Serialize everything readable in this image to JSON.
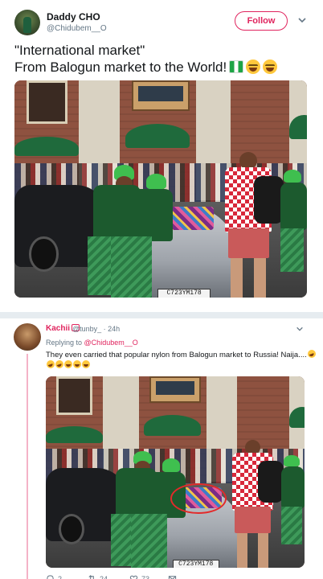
{
  "tweet": {
    "author_name": "Daddy CHO",
    "author_handle": "@Chidubem__O",
    "follow_label": "Follow",
    "text_line1": "\"International market\"",
    "text_line2": "From Balogun market to the World!",
    "photo_plate": "C723YM178"
  },
  "reply": {
    "author_name": "Kachii",
    "author_handle": "@tunby_ · 24h",
    "replying_prefix": "Replying to",
    "replying_handle": "@Chidubem__O",
    "text_line1": "They even carried that popular nylon from Balogun market to Russia! Naija....",
    "photo_plate": "C723YM178",
    "actions": {
      "reply_count": "2",
      "retweet_count": "24",
      "like_count": "73"
    }
  },
  "colors": {
    "accent": "#e0245e",
    "secondary_text": "#657786",
    "circle_highlight": "#e32a2a"
  }
}
